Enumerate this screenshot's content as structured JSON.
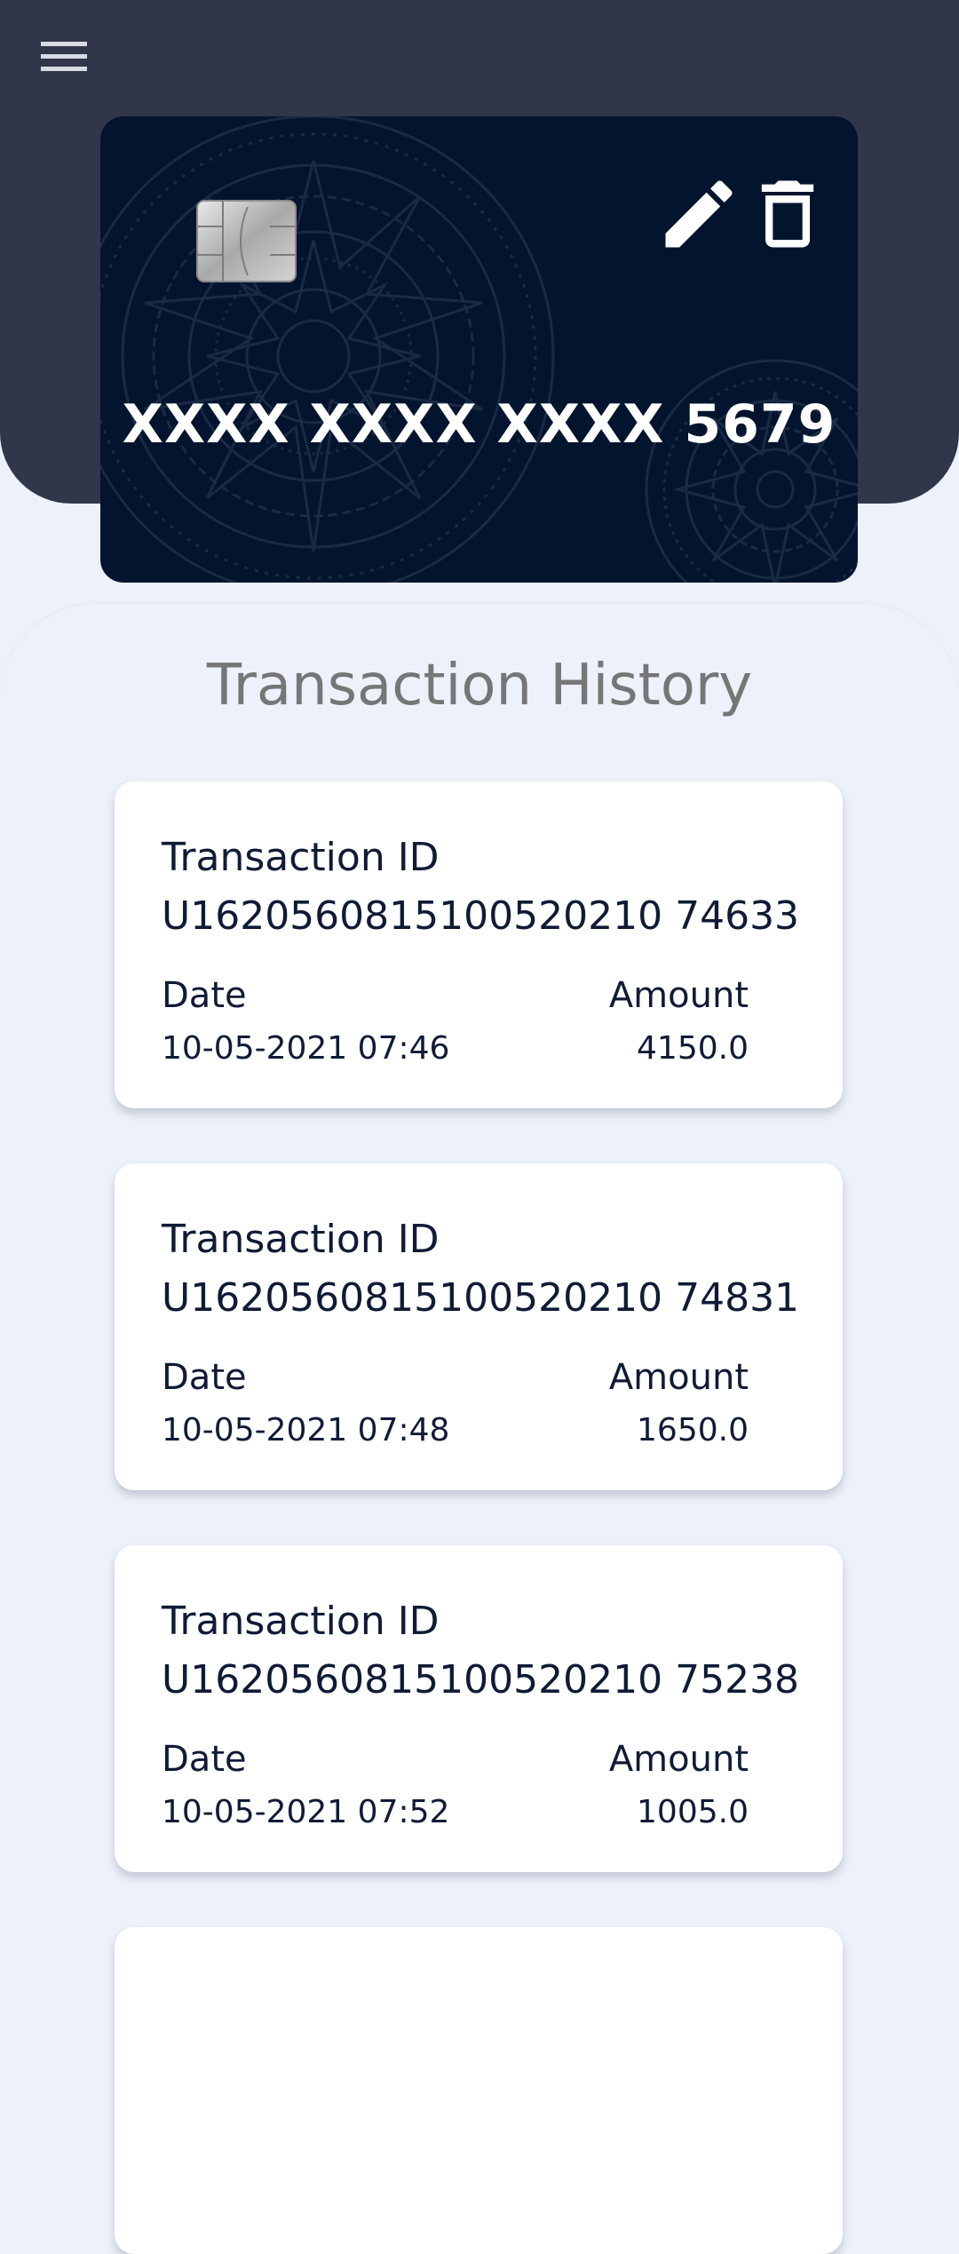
{
  "header": {
    "menu_icon": "hamburger-menu-icon"
  },
  "card": {
    "number": "XXXX XXXX XXXX 5679",
    "edit_icon": "pencil-icon",
    "delete_icon": "trash-icon",
    "chip_icon": "card-chip-icon",
    "colors": {
      "card_bg": "#03152e",
      "header_bg": "#32364a"
    }
  },
  "history": {
    "title": "Transaction History",
    "id_label": "Transaction ID",
    "date_label": "Date",
    "amount_label": "Amount",
    "transactions": [
      {
        "id": "U1620560815100520210 74633",
        "date": "10-05-2021 07:46",
        "amount": "4150.0"
      },
      {
        "id": "U1620560815100520210 74831",
        "date": "10-05-2021 07:48",
        "amount": "1650.0"
      },
      {
        "id": "U1620560815100520210 75238",
        "date": "10-05-2021 07:52",
        "amount": "1005.0"
      }
    ]
  }
}
